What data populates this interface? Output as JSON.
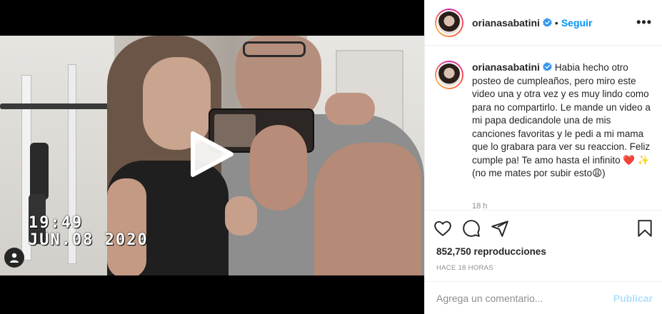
{
  "video": {
    "stamp_time": "19:49",
    "stamp_date": "JUN.08 2020",
    "play_icon": "play-icon",
    "user_tag_icon": "user-tag-icon"
  },
  "header": {
    "username": "orianasabatini",
    "verified_icon": "verified-badge-icon",
    "separator": "•",
    "follow_label": "Seguir",
    "more_icon": "more-options-icon"
  },
  "caption": {
    "username": "orianasabatini",
    "text": "Habia hecho otro posteo de cumpleaños, pero miro este video una y otra vez y es muy lindo como para no compartirlo. Le mande un video a mi papa dedicandole una de mis canciones favoritas y le pedi a mi mama que lo grabara para ver su reaccion. Feliz cumple pa! Te amo hasta el infinito ❤️ ✨ (no me mates por subir esto😩)",
    "time": "18 h"
  },
  "actions": {
    "like_icon": "heart-icon",
    "comment_icon": "comment-icon",
    "share_icon": "share-icon",
    "save_icon": "bookmark-icon",
    "views": "852,750 reproducciones",
    "posted": "HACE 18 HORAS"
  },
  "comment": {
    "placeholder": "Agrega un comentario...",
    "publish_label": "Publicar"
  },
  "colors": {
    "link_blue": "#0095f6",
    "publish_disabled": "#b2dffc",
    "muted": "#8e8e8e"
  }
}
